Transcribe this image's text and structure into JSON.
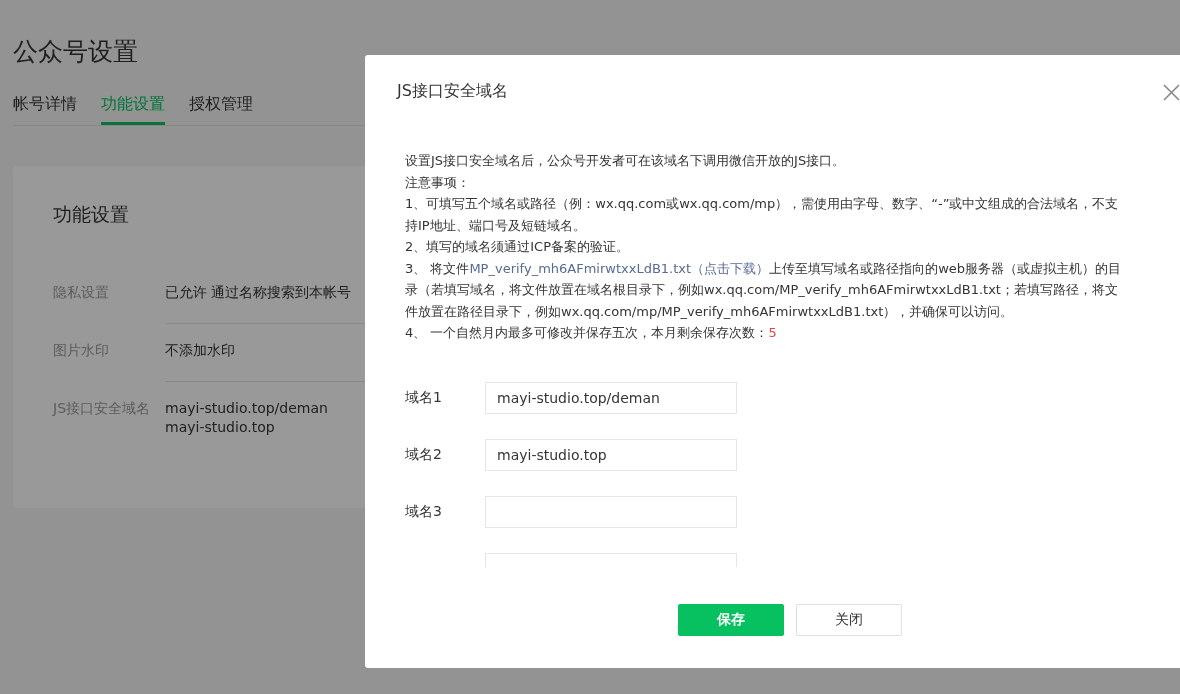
{
  "page": {
    "title": "公众号设置"
  },
  "tabs": [
    {
      "label": "帐号详情",
      "selected": false
    },
    {
      "label": "功能设置",
      "selected": true
    },
    {
      "label": "授权管理",
      "selected": false
    }
  ],
  "card": {
    "title": "功能设置",
    "rows": [
      {
        "label": "隐私设置",
        "values": [
          "已允许 通过名称搜索到本帐号"
        ]
      },
      {
        "label": "图片水印",
        "values": [
          "不添加水印"
        ]
      },
      {
        "label": "JS接口安全域名",
        "values": [
          "mayi-studio.top/deman",
          "mayi-studio.top"
        ]
      }
    ]
  },
  "dialog": {
    "title": "JS接口安全域名",
    "intro": "设置JS接口安全域名后，公众号开发者可在该域名下调用微信开放的JS接口。",
    "notice_heading": "注意事项：",
    "item_1": "1、可填写五个域名或路径（例：wx.qq.com或wx.qq.com/mp），需使用由字母、数字、“-”或中文组成的合法域名，不支持IP地址、端口号及短链域名。",
    "item_2": "2、填写的域名须通过ICP备案的验证。",
    "item_3": {
      "prefix": "3、 将文件",
      "link": "MP_verify_mh6AFmirwtxxLdB1.txt（点击下载）",
      "suffix": "上传至填写域名或路径指向的web服务器（或虚拟主机）的目录（若填写域名，将文件放置在域名根目录下，例如wx.qq.com/MP_verify_mh6AFmirwtxxLdB1.txt；若填写路径，将文件放置在路径目录下，例如wx.qq.com/mp/MP_verify_mh6AFmirwtxxLdB1.txt），并确保可以访问。"
    },
    "item_4": {
      "text": "4、 一个自然月内最多可修改并保存五次，本月剩余保存次数：",
      "count": "5"
    },
    "fields": [
      {
        "kind": "input",
        "label": "域名1",
        "value": "mayi-studio.top/deman"
      },
      {
        "kind": "input",
        "label": "域名2",
        "value": "mayi-studio.top"
      },
      {
        "kind": "input",
        "label": "域名3"
      },
      {
        "kind": "input"
      }
    ],
    "buttons": [
      {
        "label": "保存",
        "kind": "primary"
      },
      {
        "label": "关闭",
        "kind": "default"
      }
    ]
  }
}
